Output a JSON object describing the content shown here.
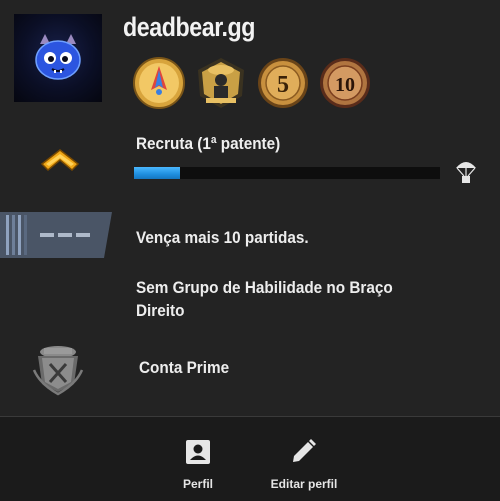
{
  "profile": {
    "username": "deadbear.gg",
    "medals": [
      {
        "icon": "operation-hydra-coin-icon",
        "color": "#d8a43c"
      },
      {
        "icon": "counter-strike-badge-icon",
        "color": "#c9a045"
      },
      {
        "icon": "5-year-veteran-coin-icon",
        "label": "5",
        "color": "#c8903e"
      },
      {
        "icon": "10-year-veteran-coin-icon",
        "label": "10",
        "color": "#b07540"
      }
    ]
  },
  "rank": {
    "title": "Recruta (1ª patente)",
    "progress": 0.15,
    "icon": "chevron-rank-icon",
    "reward_icon": "parachute-drop-icon"
  },
  "wins": {
    "text": "Vença mais 10 partidas.",
    "icon": "skill-group-placeholder-icon"
  },
  "skill": {
    "text": "Sem Grupo de Habilidade no Braço Direito"
  },
  "prime": {
    "text": "Conta Prime",
    "icon": "prime-emblem-icon"
  },
  "nav": {
    "profile_label": "Perfil",
    "edit_label": "Editar perfil"
  },
  "colors": {
    "background": "#232323",
    "bottom_bar": "#1b1b1b",
    "progress_fill": "#2a9bea",
    "chevron": "#f0a818"
  }
}
